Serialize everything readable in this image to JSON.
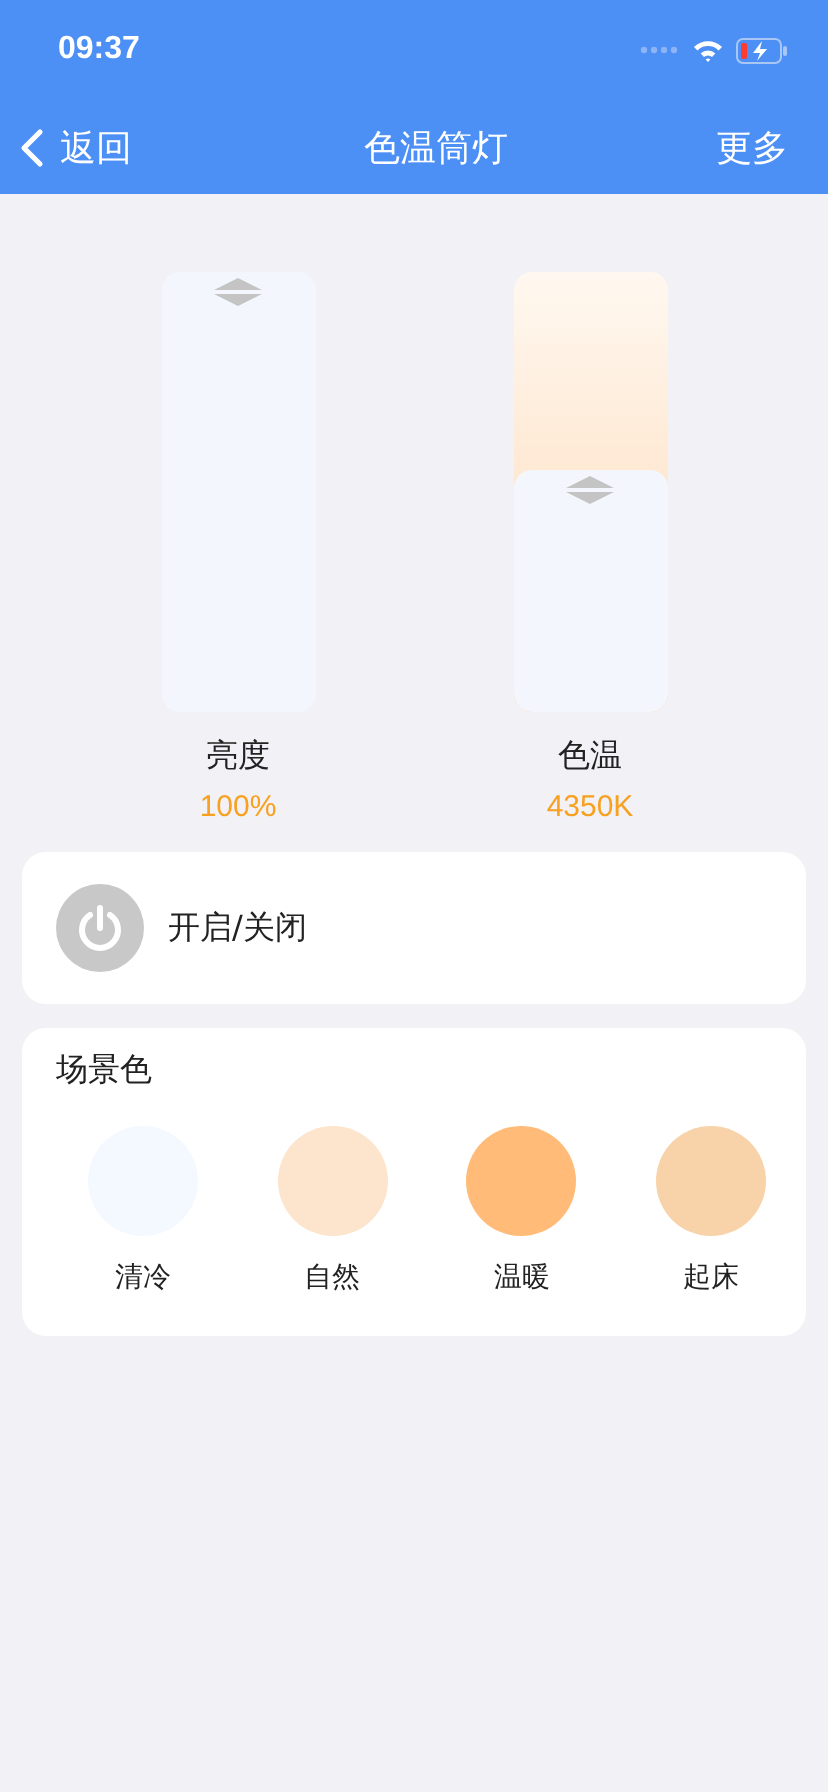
{
  "status_bar": {
    "time": "09:37"
  },
  "nav": {
    "back": "返回",
    "title": "色温筒灯",
    "more": "更多"
  },
  "sliders": [
    {
      "kind": "brightness",
      "label": "亮度",
      "reading": "100%",
      "level": 1
    },
    {
      "kind": "temperature",
      "label": "色温",
      "reading": "4350K",
      "level": 0.55
    }
  ],
  "power": {
    "label": "开启/关闭",
    "on": false
  },
  "scenes": {
    "title": "场景色",
    "items": [
      {
        "label": "清冷",
        "color": "#f4f8ff"
      },
      {
        "label": "自然",
        "color": "#fde4cc"
      },
      {
        "label": "温暖",
        "color": "#ffbb77"
      },
      {
        "label": "起床",
        "color": "#f8d2a8"
      }
    ]
  }
}
